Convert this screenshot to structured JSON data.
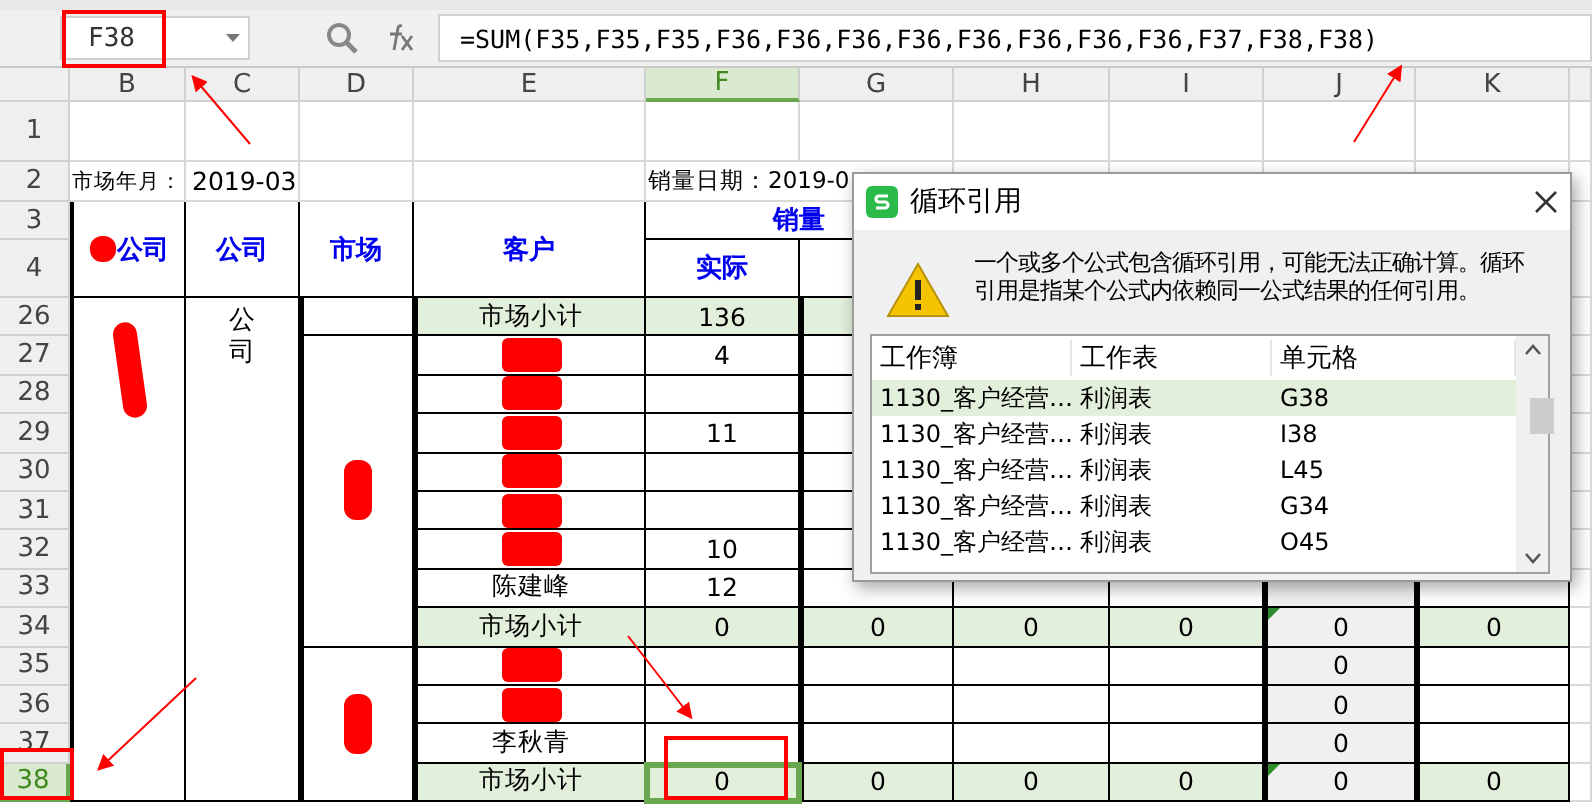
{
  "formula_bar": {
    "name_box": "F38",
    "formula": "=SUM(F35,F35,F35,F36,F36,F36,F36,F36,F36,F36,F36,F37,F38,F38)"
  },
  "columns": [
    {
      "label": "B",
      "selected": false
    },
    {
      "label": "C",
      "selected": false
    },
    {
      "label": "D",
      "selected": false
    },
    {
      "label": "E",
      "selected": false
    },
    {
      "label": "F",
      "selected": true
    },
    {
      "label": "G",
      "selected": false
    },
    {
      "label": "H",
      "selected": false
    },
    {
      "label": "I",
      "selected": false
    },
    {
      "label": "J",
      "selected": false
    },
    {
      "label": "K",
      "selected": false
    }
  ],
  "top_rows": [
    "1",
    "2",
    "3",
    "4"
  ],
  "info": {
    "month_label": "市场年月：",
    "month": "2019-03",
    "date_label": "销量日期：2019-0"
  },
  "header": {
    "group": {
      "text": "公司",
      "redacted": true
    },
    "company": "公司",
    "market": "市场",
    "customer": "客户",
    "sales": "销量",
    "actual": "实际"
  },
  "section": {
    "group_redacted": true,
    "company": "公司",
    "markets": [
      {
        "redacted": false,
        "rows": [
          {
            "num": "26",
            "selected": false,
            "kind": "subtotal",
            "customer": "市场小计",
            "cells": {
              "F": "136"
            }
          }
        ]
      },
      {
        "redacted": true,
        "rows": [
          {
            "num": "27",
            "selected": false,
            "kind": "detail",
            "redacted": true,
            "cells": {
              "F": "4"
            }
          },
          {
            "num": "28",
            "selected": false,
            "kind": "detail",
            "redacted": true,
            "cells": {}
          },
          {
            "num": "29",
            "selected": false,
            "kind": "detail",
            "redacted": true,
            "cells": {
              "F": "11"
            }
          },
          {
            "num": "30",
            "selected": false,
            "kind": "detail",
            "redacted": true,
            "cells": {}
          },
          {
            "num": "31",
            "selected": false,
            "kind": "detail",
            "redacted": true,
            "cells": {}
          },
          {
            "num": "32",
            "selected": false,
            "kind": "detail",
            "redacted": true,
            "cells": {
              "F": "10"
            }
          },
          {
            "num": "33",
            "selected": false,
            "kind": "detail",
            "customer": "陈建峰",
            "cells": {
              "F": "12"
            }
          },
          {
            "num": "34",
            "selected": false,
            "kind": "subtotal",
            "customer": "市场小计",
            "flagged": true,
            "cells": {
              "F": "0",
              "G": "0",
              "H": "0",
              "I": "0",
              "J": "0",
              "K": "0"
            }
          }
        ]
      },
      {
        "redacted": true,
        "rows": [
          {
            "num": "35",
            "selected": false,
            "kind": "detail",
            "redacted": true,
            "cells": {
              "J": "0"
            }
          },
          {
            "num": "36",
            "selected": false,
            "kind": "detail",
            "redacted": true,
            "cells": {
              "J": "0"
            }
          },
          {
            "num": "37",
            "selected": false,
            "kind": "detail",
            "customer": "李秋青",
            "cells": {
              "J": "0"
            }
          },
          {
            "num": "38",
            "selected": true,
            "kind": "subtotal",
            "customer": "市场小计",
            "flagged": true,
            "cells": {
              "F": "0",
              "G": "0",
              "H": "0",
              "I": "0",
              "J": "0",
              "K": "0"
            }
          }
        ]
      }
    ]
  },
  "dialog": {
    "title": "循环引用",
    "message": "一个或多个公式包含循环引用，可能无法正确计算。循环引用是指某个公式内依赖同一公式结果的任何引用。",
    "columns": [
      "工作簿",
      "工作表",
      "单元格"
    ],
    "rows": [
      {
        "workbook": "1130_客户经营…",
        "sheet": "利润表",
        "cell": "G38",
        "selected": true
      },
      {
        "workbook": "1130_客户经营…",
        "sheet": "利润表",
        "cell": "I38",
        "selected": false
      },
      {
        "workbook": "1130_客户经营…",
        "sheet": "利润表",
        "cell": "L45",
        "selected": false
      },
      {
        "workbook": "1130_客户经营…",
        "sheet": "利润表",
        "cell": "G34",
        "selected": false
      },
      {
        "workbook": "1130_客户经营…",
        "sheet": "利润表",
        "cell": "O45",
        "selected": false
      }
    ]
  }
}
